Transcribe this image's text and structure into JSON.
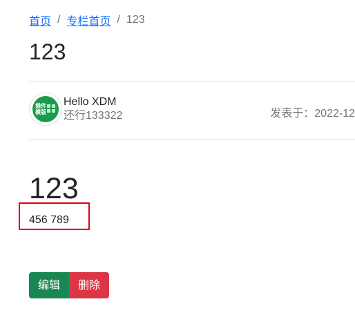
{
  "breadcrumb": {
    "home": "首页",
    "column_home": "专栏首页",
    "current": "123",
    "separator": "/"
  },
  "page_title": "123",
  "author": {
    "avatar_text": "插件模版",
    "name": "Hello XDM",
    "subtitle": "还行133322"
  },
  "published": "发表于：2022-12",
  "content": {
    "heading": "123",
    "text": "456 789"
  },
  "actions": {
    "edit_label": "编辑",
    "delete_label": "删除"
  },
  "colors": {
    "link": "#0d6efd",
    "edit_button": "#198754",
    "delete_button": "#dc3545",
    "highlight_box": "#e60012",
    "avatar_bg": "#1a9a4a"
  }
}
